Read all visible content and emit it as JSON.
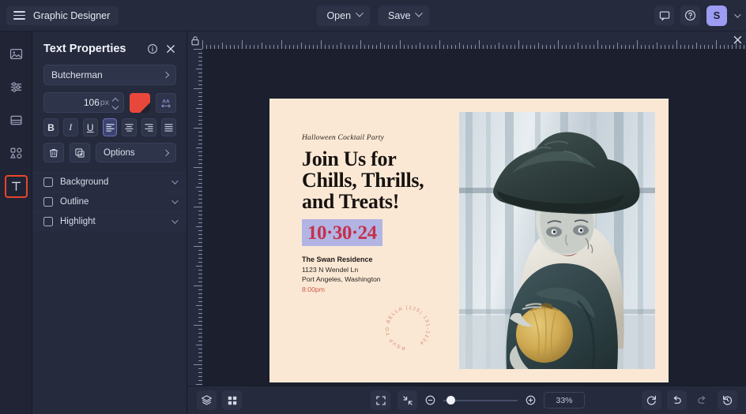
{
  "app": {
    "title": "Graphic Designer",
    "menu_icon": "hamburger-icon"
  },
  "topbar": {
    "open_label": "Open",
    "save_label": "Save",
    "comment_icon": "comment-icon",
    "help_icon": "help-circle-icon",
    "avatar_initial": "S"
  },
  "rail": {
    "items": [
      {
        "name": "image-tool",
        "icon": "image-icon"
      },
      {
        "name": "adjust-tool",
        "icon": "sliders-icon"
      },
      {
        "name": "layout-tool",
        "icon": "layout-icon"
      },
      {
        "name": "shapes-tool",
        "icon": "shapes-icon"
      },
      {
        "name": "text-tool",
        "icon": "text-t-icon",
        "active": true
      }
    ],
    "active_outline_color": "#e8472a"
  },
  "panel": {
    "title": "Text Properties",
    "info_icon": "info-circle-icon",
    "close_icon": "close-icon",
    "font_family": "Butcherman",
    "font_size": "106",
    "font_size_unit": "px",
    "color_value": "#e8483c",
    "letter_spacing_icon": "letter-spacing-icon",
    "format": {
      "bold": "B",
      "italic": "I",
      "underline": "U",
      "align_left": "align-left-icon",
      "align_center": "align-center-icon",
      "align_right": "align-right-icon",
      "align_justify": "align-justify-icon",
      "selected_align": "align-left-icon"
    },
    "delete_icon": "trash-icon",
    "duplicate_icon": "duplicate-icon",
    "options_label": "Options",
    "toggles": [
      {
        "label": "Background",
        "checked": false
      },
      {
        "label": "Outline",
        "checked": false
      },
      {
        "label": "Highlight",
        "checked": false
      }
    ]
  },
  "canvas": {
    "lock_icon": "lock-icon",
    "ruler_close_icon": "close-icon",
    "background_color": "#1b1f2e"
  },
  "poster": {
    "background_color": "#fbe8d4",
    "eyebrow": "Halloween Cocktail Party",
    "headline_line1": "Join Us for",
    "headline_line2": "Chills, Thrills,",
    "headline_line3": "and Treats!",
    "date": "10·30·24",
    "date_color": "#c4314c",
    "date_highlight_color": "#b2b4e4",
    "venue": "The Swan Residence",
    "address_line1": "1123 N Wendel Ln",
    "address_line2": "Port Angeles, Washington",
    "time": "8:00pm",
    "stamp_text": "RSVP TO BELLA (125) 131-1234",
    "photo_alt": "woman-in-witch-costume-holding-pumpkin"
  },
  "bottombar": {
    "layers_icon": "layers-icon",
    "grid_icon": "grid-icon",
    "fit_screen_icon": "fit-screen-icon",
    "collapse_icon": "collapse-icon",
    "zoom_out_icon": "zoom-out-icon",
    "zoom_in_icon": "zoom-in-icon",
    "zoom_level": "33%",
    "slider_position_percent": 8,
    "reset_icon": "reset-icon",
    "undo_icon": "undo-icon",
    "redo_icon": "redo-icon",
    "history_icon": "history-icon"
  }
}
